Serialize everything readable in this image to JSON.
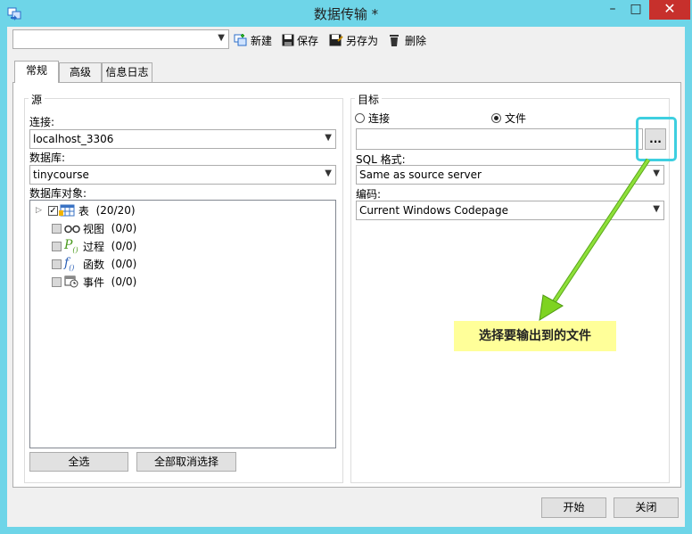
{
  "window": {
    "title": "数据传输 *",
    "min": "–",
    "max": "□",
    "close": "✕"
  },
  "toolbar": {
    "profile_value": "",
    "new_label": "新建",
    "save_label": "保存",
    "saveas_label": "另存为",
    "delete_label": "删除"
  },
  "tabs": [
    "常规",
    "高级",
    "信息日志"
  ],
  "source": {
    "group_label": "源",
    "connection_label": "连接:",
    "connection_value": "localhost_3306",
    "database_label": "数据库:",
    "database_value": "tinycourse",
    "objects_label": "数据库对象:",
    "tree": [
      {
        "label": "表",
        "count": "(20/20)"
      },
      {
        "label": "视图",
        "count": "(0/0)"
      },
      {
        "label": "过程",
        "count": "(0/0)"
      },
      {
        "label": "函数",
        "count": "(0/0)"
      },
      {
        "label": "事件",
        "count": "(0/0)"
      }
    ],
    "select_all": "全选",
    "deselect_all": "全部取消选择"
  },
  "target": {
    "group_label": "目标",
    "radio_connection": "连接",
    "radio_file": "文件",
    "selected": "文件",
    "file_path": "",
    "browse_label": "...",
    "sql_format_label": "SQL 格式:",
    "sql_format_value": "Same as source server",
    "encoding_label": "编码:",
    "encoding_value": "Current Windows Codepage"
  },
  "annotation": {
    "text": "选择要输出到的文件",
    "arrow_color": "#7ed321",
    "highlight_color": "#3ecfe0"
  },
  "footer": {
    "start": "开始",
    "close": "关闭"
  }
}
